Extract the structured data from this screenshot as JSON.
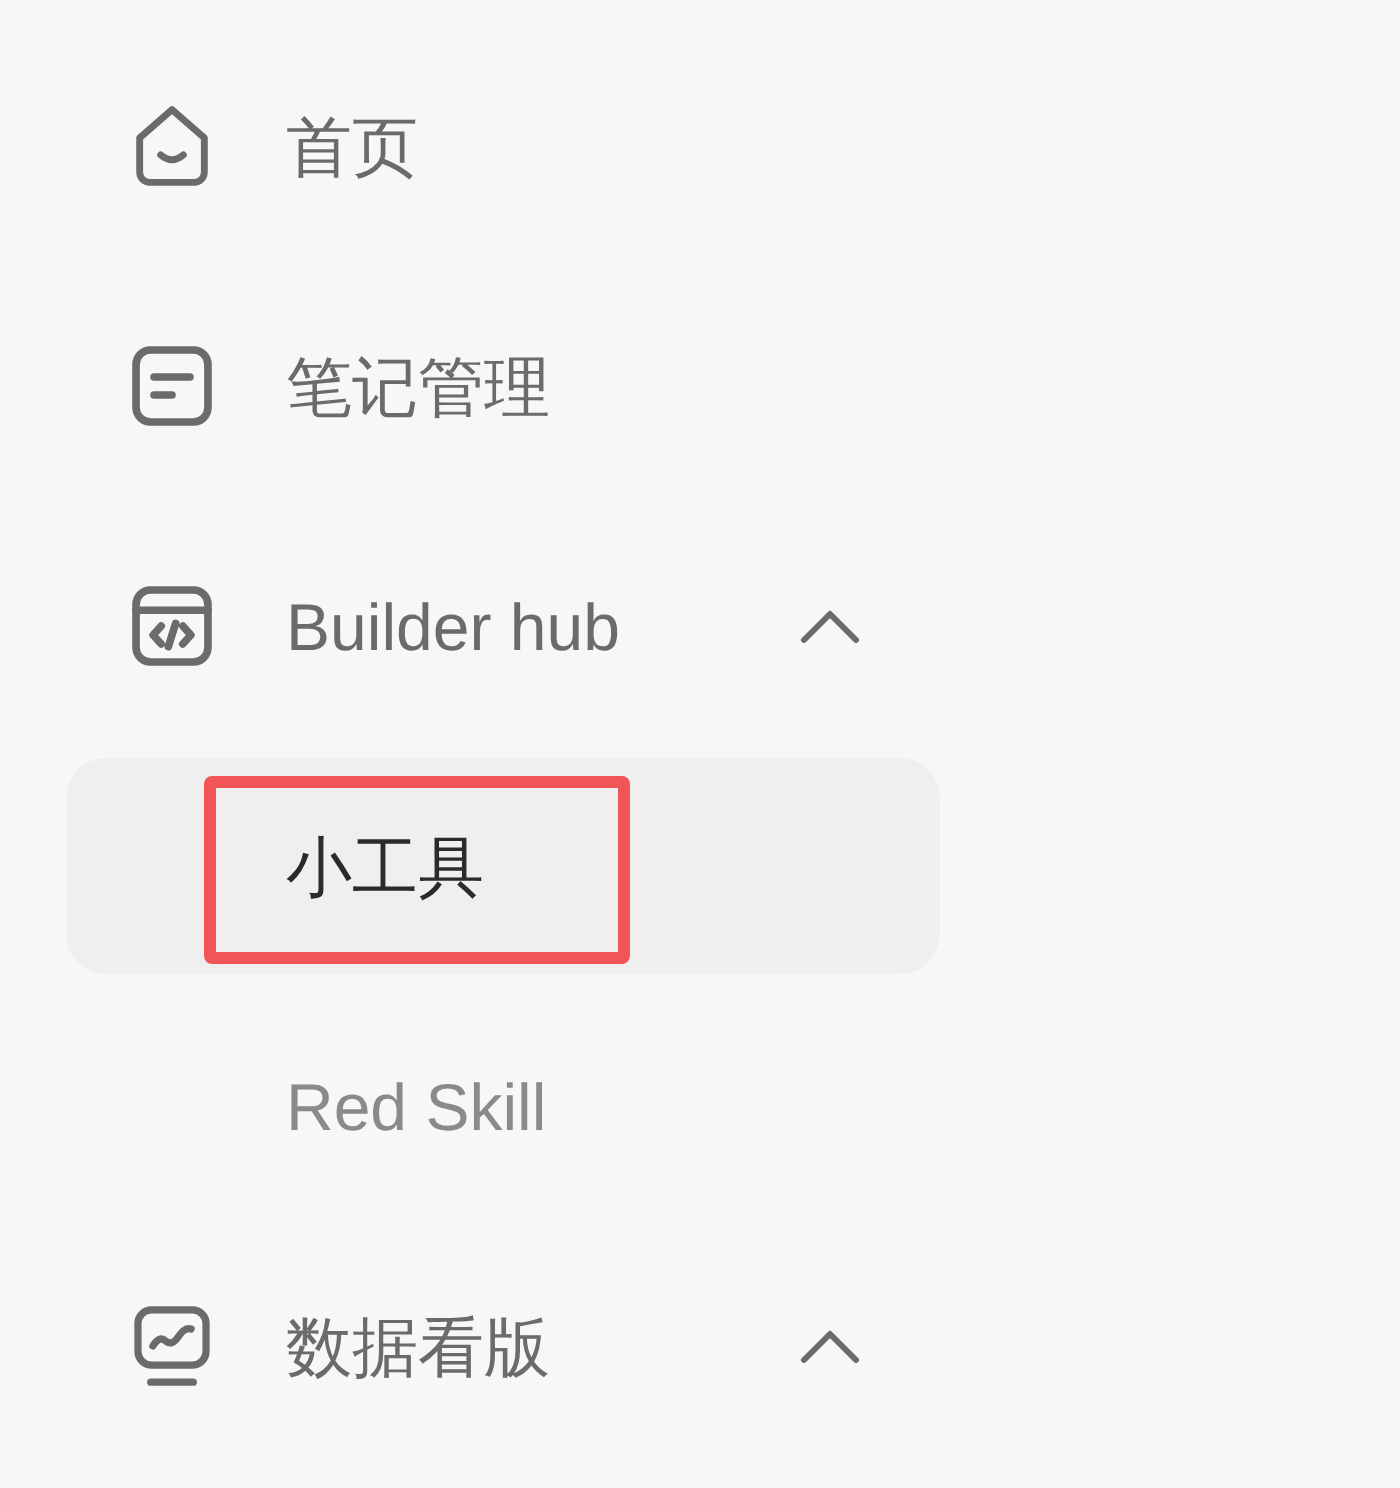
{
  "nav": {
    "items": [
      {
        "label": "首页"
      },
      {
        "label": "笔记管理"
      },
      {
        "label": "Builder hub",
        "expanded": true,
        "children": [
          {
            "label": "小工具",
            "selected": true,
            "annotated": true
          },
          {
            "label": "Red Skill",
            "selected": false,
            "annotated": false
          }
        ]
      },
      {
        "label": "数据看版",
        "expanded": true
      }
    ]
  }
}
